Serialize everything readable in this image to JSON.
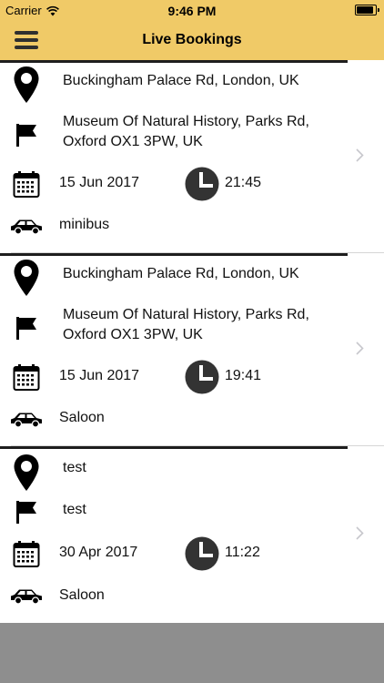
{
  "status": {
    "carrier": "Carrier",
    "time": "9:46 PM",
    "battery_level": 0.9
  },
  "header": {
    "title": "Live Bookings"
  },
  "bookings": [
    {
      "pickup": "Buckingham Palace Rd, London, UK",
      "dropoff_line1": "Museum Of Natural History, Parks Rd,",
      "dropoff_line2": "Oxford OX1 3PW, UK",
      "date": "15 Jun 2017",
      "time": "21:45",
      "vehicle": "minibus"
    },
    {
      "pickup": "Buckingham Palace Rd, London, UK",
      "dropoff_line1": "Museum Of Natural History, Parks Rd,",
      "dropoff_line2": "Oxford OX1 3PW, UK",
      "date": "15 Jun 2017",
      "time": "19:41",
      "vehicle": "Saloon"
    },
    {
      "pickup": "test",
      "dropoff_line1": "test",
      "dropoff_line2": "",
      "date": "30 Apr 2017",
      "time": "11:22",
      "vehicle": "Saloon"
    }
  ],
  "colors": {
    "header_bg": "#f0ca67",
    "footer_bg": "#8e8e8e",
    "icon": "#000000",
    "divider": "#1e1e1e"
  },
  "icons": [
    "menu-icon",
    "wifi-icon",
    "battery-icon",
    "location-pin-icon",
    "flag-icon",
    "calendar-icon",
    "clock-icon",
    "car-icon",
    "chevron-right-icon"
  ]
}
